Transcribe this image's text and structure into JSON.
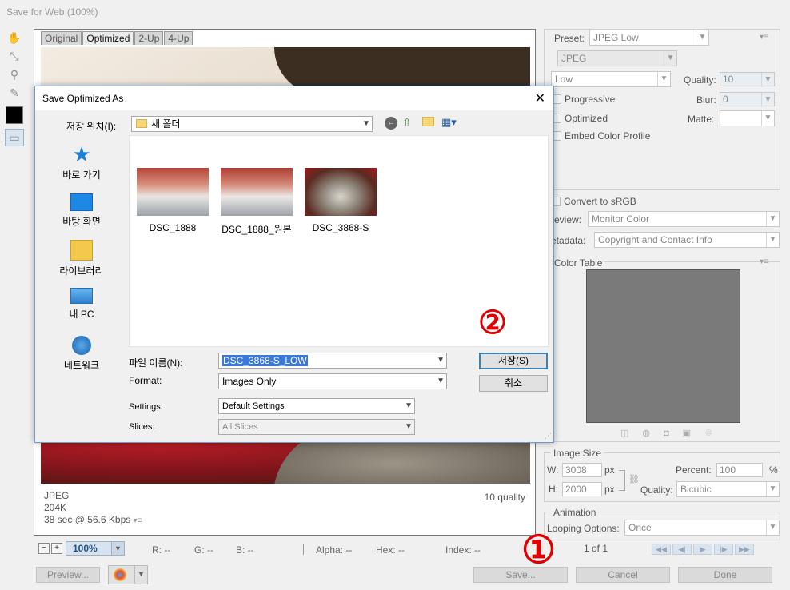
{
  "window": {
    "title": "Save for Web (100%)"
  },
  "tabs": [
    "Original",
    "Optimized",
    "2-Up",
    "4-Up"
  ],
  "tools": [
    "hand-icon",
    "slice-select-icon",
    "zoom-icon",
    "eyedropper-icon"
  ],
  "preview_info": {
    "format": "JPEG",
    "size": "204K",
    "time": "38 sec @ 56.6 Kbps",
    "quality": "10 quality"
  },
  "statusbar": {
    "zoom": "100%",
    "r": "R: --",
    "g": "G: --",
    "b": "B: --",
    "alpha": "Alpha: --",
    "hex": "Hex: --",
    "index": "Index: --"
  },
  "footer": {
    "preview": "Preview...",
    "save": "Save...",
    "cancel": "Cancel",
    "done": "Done"
  },
  "settings": {
    "preset_label": "Preset:",
    "preset": "JPEG Low",
    "format": "JPEG",
    "quality_preset": "Low",
    "quality_label": "Quality:",
    "quality": "10",
    "progressive": "Progressive",
    "blur_label": "Blur:",
    "blur": "0",
    "optimized": "Optimized",
    "matte_label": "Matte:",
    "embed": "Embed Color Profile",
    "convert": "Convert to sRGB",
    "preview_label": "review:",
    "preview_value": "Monitor Color",
    "metadata_label": "etadata:",
    "metadata_value": "Copyright and Contact Info",
    "color_table": "Color Table"
  },
  "image_size": {
    "title": "Image Size",
    "w_label": "W:",
    "w": "3008",
    "h_label": "H:",
    "h": "2000",
    "px": "px",
    "percent_label": "Percent:",
    "percent": "100",
    "pct": "%",
    "quality_label": "Quality:",
    "quality": "Bicubic"
  },
  "animation": {
    "title": "Animation",
    "looping_label": "Looping Options:",
    "looping": "Once",
    "frame": "1 of 1"
  },
  "dialog": {
    "title": "Save Optimized As",
    "location_label": "저장 위치(I):",
    "location": "새 폴더",
    "sidebar": [
      "바로 가기",
      "바탕 화면",
      "라이브러리",
      "내 PC",
      "네트워크"
    ],
    "files": [
      "DSC_1888",
      "DSC_1888_원본",
      "DSC_3868-S"
    ],
    "filename_label": "파일 이름(N):",
    "filename": "DSC_3868-S_LOW",
    "format_label": "Format:",
    "format": "Images Only",
    "settings_label": "Settings:",
    "settings": "Default Settings",
    "slices_label": "Slices:",
    "slices": "All Slices",
    "save": "저장(S)",
    "cancel": "취소"
  },
  "colors": {
    "accent": "#3b78d8",
    "annotation": "#e10000",
    "selected_zoom": "#d7e3ef"
  }
}
